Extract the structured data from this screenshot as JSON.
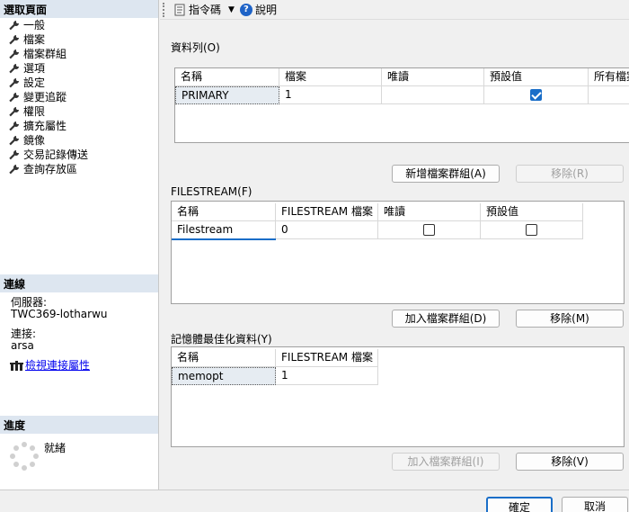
{
  "left": {
    "select_page_heading": "選取頁面",
    "pages": [
      "一般",
      "檔案",
      "檔案群組",
      "選項",
      "設定",
      "變更追蹤",
      "權限",
      "擴充屬性",
      "鏡像",
      "交易記錄傳送",
      "查詢存放區"
    ],
    "connection_heading": "連線",
    "server_label": "伺服器:",
    "server_value": "TWC369-lotharwu",
    "connection_label": "連接:",
    "connection_value": "arsa",
    "view_connection_props": "檢視連接屬性",
    "progress_heading": "進度",
    "progress_status": "就緒"
  },
  "toolbar": {
    "script_label": "指令碼",
    "help_label": "說明"
  },
  "rows_section": {
    "title": "資料列(O)",
    "headers": [
      "名稱",
      "檔案",
      "唯讀",
      "預設值",
      "所有檔案"
    ],
    "row": {
      "name": "PRIMARY",
      "files": "1",
      "readonly": false,
      "default": true
    },
    "add_button": "新增檔案群組(A)",
    "remove_button": "移除(R)"
  },
  "filestream_section": {
    "title": "FILESTREAM(F)",
    "headers": [
      "名稱",
      "FILESTREAM 檔案",
      "唯讀",
      "預設值"
    ],
    "row": {
      "name": "Filestream",
      "files": "0",
      "readonly": false,
      "default": false
    },
    "add_button": "加入檔案群組(D)",
    "remove_button": "移除(M)"
  },
  "memopt_section": {
    "title": "記憶體最佳化資料(Y)",
    "headers": [
      "名稱",
      "FILESTREAM 檔案"
    ],
    "row": {
      "name": "memopt",
      "files": "1"
    },
    "add_button": "加入檔案群組(I)",
    "remove_button": "移除(V)"
  },
  "footer": {
    "ok": "確定",
    "cancel": "取消"
  },
  "colors": {
    "accent": "#1a6ec8",
    "header_bg": "#dde6f0",
    "link": "#0000ee"
  }
}
